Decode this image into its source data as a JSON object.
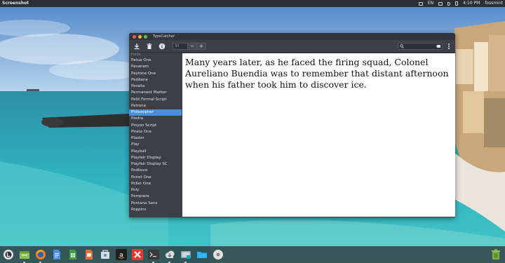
{
  "top_panel": {
    "app_name": "Screenshot",
    "keyboard_layout": "EN",
    "clock": "4:10 PM",
    "user": "fossmint"
  },
  "window": {
    "title": "TypeCatcher",
    "toolbar": {
      "download_icon": "download-icon",
      "delete_icon": "trash-icon",
      "info_icon": "info-icon",
      "font_size": "30",
      "decrease_label": "−",
      "increase_label": "+",
      "search_placeholder": "",
      "menu_icon": "kebab-menu-icon"
    },
    "font_list": {
      "header": "Fonts",
      "items": [
        "Patua One",
        "Pavanam",
        "Paytone One",
        "Peddana",
        "Peralta",
        "Permanent Marker",
        "Petit Formal Script",
        "Petrona",
        "Philosopher",
        "Piedra",
        "Pinyon Script",
        "Pirata One",
        "Plaster",
        "Play",
        "Playball",
        "Playfair Display",
        "Playfair Display SC",
        "Podkova",
        "Poiret One",
        "Poller One",
        "Poly",
        "Pompiere",
        "Pontano Sans",
        "Poppins"
      ],
      "selected": "Philosopher"
    },
    "preview_text": "Many years later, as he faced the firing squad, Colonel Aureliano Buendia was to remember that distant afternoon when his father took him to discover ice."
  },
  "dock": {
    "items": [
      "menu-icon",
      "files-icon",
      "firefox-icon",
      "document-icon",
      "spreadsheet-icon",
      "software-icon",
      "amazon-icon",
      "xmind-icon",
      "terminal-icon",
      "cloud-download-icon",
      "screenshot-icon",
      "folder-icon",
      "disc-icon"
    ],
    "trash_icon": "trash-icon"
  },
  "colors": {
    "selection": "#4a90d9",
    "window_bg": "#3c3f46",
    "panel_bg": "#2b2e33"
  }
}
